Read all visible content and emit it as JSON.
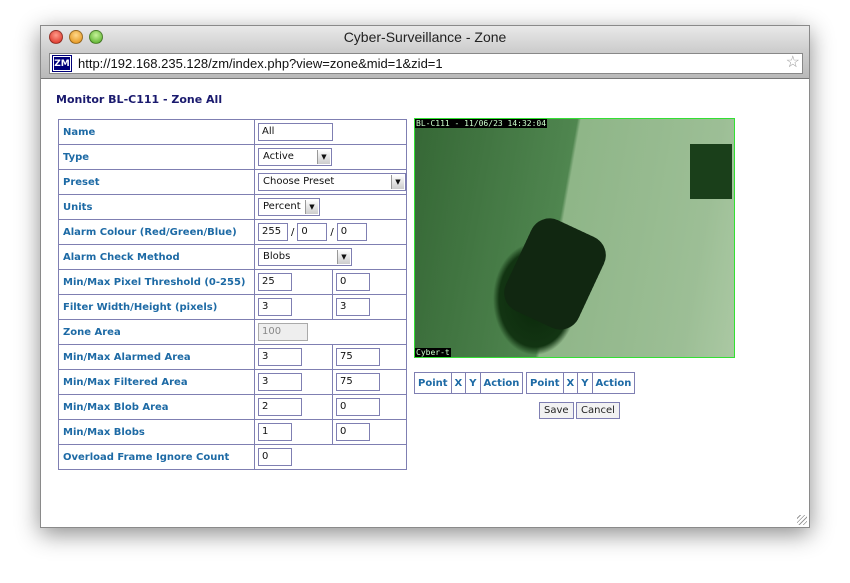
{
  "window": {
    "title": "Cyber-Surveillance - Zone",
    "url": "http://192.168.235.128/zm/index.php?view=zone&mid=1&zid=1",
    "favicon": "ZM"
  },
  "page": {
    "heading": "Monitor BL-C111 - Zone All"
  },
  "form": {
    "rows": [
      {
        "label": "Name",
        "kind": "input",
        "values": [
          "All"
        ]
      },
      {
        "label": "Type",
        "kind": "select",
        "values": [
          "Active"
        ]
      },
      {
        "label": "Preset",
        "kind": "select",
        "values": [
          "Choose Preset"
        ]
      },
      {
        "label": "Units",
        "kind": "select",
        "values": [
          "Percent"
        ]
      },
      {
        "label": "Alarm Colour (Red/Green/Blue)",
        "kind": "rgb",
        "values": [
          "255",
          "0",
          "0"
        ]
      },
      {
        "label": "Alarm Check Method",
        "kind": "select",
        "values": [
          "Blobs"
        ]
      },
      {
        "label": "Min/Max Pixel Threshold (0-255)",
        "kind": "pair",
        "values": [
          "25",
          "0"
        ]
      },
      {
        "label": "Filter Width/Height (pixels)",
        "kind": "pair",
        "values": [
          "3",
          "3"
        ]
      },
      {
        "label": "Zone Area",
        "kind": "disabled",
        "values": [
          "100"
        ]
      },
      {
        "label": "Min/Max Alarmed Area",
        "kind": "pair",
        "values": [
          "3",
          "75"
        ]
      },
      {
        "label": "Min/Max Filtered Area",
        "kind": "pair",
        "values": [
          "3",
          "75"
        ]
      },
      {
        "label": "Min/Max Blob Area",
        "kind": "pair",
        "values": [
          "2",
          "0"
        ]
      },
      {
        "label": "Min/Max Blobs",
        "kind": "pair",
        "values": [
          "1",
          "0"
        ]
      },
      {
        "label": "Overload Frame Ignore Count",
        "kind": "input",
        "values": [
          "0"
        ]
      }
    ]
  },
  "camera": {
    "timestamp": "BL-C111 - 11/06/23 14:32:04",
    "caption": "Cyber-t"
  },
  "points_headers": [
    "Point",
    "X",
    "Y",
    "Action"
  ],
  "buttons": {
    "save": "Save",
    "cancel": "Cancel"
  }
}
